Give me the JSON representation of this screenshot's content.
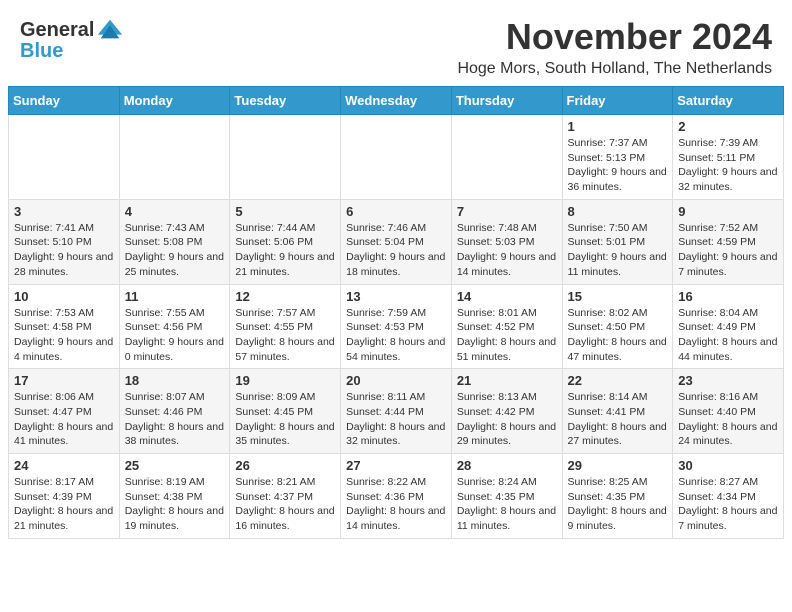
{
  "header": {
    "logo_line1": "General",
    "logo_line2": "Blue",
    "month_title": "November 2024",
    "location": "Hoge Mors, South Holland, The Netherlands"
  },
  "weekdays": [
    "Sunday",
    "Monday",
    "Tuesday",
    "Wednesday",
    "Thursday",
    "Friday",
    "Saturday"
  ],
  "weeks": [
    [
      {
        "day": "",
        "info": ""
      },
      {
        "day": "",
        "info": ""
      },
      {
        "day": "",
        "info": ""
      },
      {
        "day": "",
        "info": ""
      },
      {
        "day": "",
        "info": ""
      },
      {
        "day": "1",
        "info": "Sunrise: 7:37 AM\nSunset: 5:13 PM\nDaylight: 9 hours and 36 minutes."
      },
      {
        "day": "2",
        "info": "Sunrise: 7:39 AM\nSunset: 5:11 PM\nDaylight: 9 hours and 32 minutes."
      }
    ],
    [
      {
        "day": "3",
        "info": "Sunrise: 7:41 AM\nSunset: 5:10 PM\nDaylight: 9 hours and 28 minutes."
      },
      {
        "day": "4",
        "info": "Sunrise: 7:43 AM\nSunset: 5:08 PM\nDaylight: 9 hours and 25 minutes."
      },
      {
        "day": "5",
        "info": "Sunrise: 7:44 AM\nSunset: 5:06 PM\nDaylight: 9 hours and 21 minutes."
      },
      {
        "day": "6",
        "info": "Sunrise: 7:46 AM\nSunset: 5:04 PM\nDaylight: 9 hours and 18 minutes."
      },
      {
        "day": "7",
        "info": "Sunrise: 7:48 AM\nSunset: 5:03 PM\nDaylight: 9 hours and 14 minutes."
      },
      {
        "day": "8",
        "info": "Sunrise: 7:50 AM\nSunset: 5:01 PM\nDaylight: 9 hours and 11 minutes."
      },
      {
        "day": "9",
        "info": "Sunrise: 7:52 AM\nSunset: 4:59 PM\nDaylight: 9 hours and 7 minutes."
      }
    ],
    [
      {
        "day": "10",
        "info": "Sunrise: 7:53 AM\nSunset: 4:58 PM\nDaylight: 9 hours and 4 minutes."
      },
      {
        "day": "11",
        "info": "Sunrise: 7:55 AM\nSunset: 4:56 PM\nDaylight: 9 hours and 0 minutes."
      },
      {
        "day": "12",
        "info": "Sunrise: 7:57 AM\nSunset: 4:55 PM\nDaylight: 8 hours and 57 minutes."
      },
      {
        "day": "13",
        "info": "Sunrise: 7:59 AM\nSunset: 4:53 PM\nDaylight: 8 hours and 54 minutes."
      },
      {
        "day": "14",
        "info": "Sunrise: 8:01 AM\nSunset: 4:52 PM\nDaylight: 8 hours and 51 minutes."
      },
      {
        "day": "15",
        "info": "Sunrise: 8:02 AM\nSunset: 4:50 PM\nDaylight: 8 hours and 47 minutes."
      },
      {
        "day": "16",
        "info": "Sunrise: 8:04 AM\nSunset: 4:49 PM\nDaylight: 8 hours and 44 minutes."
      }
    ],
    [
      {
        "day": "17",
        "info": "Sunrise: 8:06 AM\nSunset: 4:47 PM\nDaylight: 8 hours and 41 minutes."
      },
      {
        "day": "18",
        "info": "Sunrise: 8:07 AM\nSunset: 4:46 PM\nDaylight: 8 hours and 38 minutes."
      },
      {
        "day": "19",
        "info": "Sunrise: 8:09 AM\nSunset: 4:45 PM\nDaylight: 8 hours and 35 minutes."
      },
      {
        "day": "20",
        "info": "Sunrise: 8:11 AM\nSunset: 4:44 PM\nDaylight: 8 hours and 32 minutes."
      },
      {
        "day": "21",
        "info": "Sunrise: 8:13 AM\nSunset: 4:42 PM\nDaylight: 8 hours and 29 minutes."
      },
      {
        "day": "22",
        "info": "Sunrise: 8:14 AM\nSunset: 4:41 PM\nDaylight: 8 hours and 27 minutes."
      },
      {
        "day": "23",
        "info": "Sunrise: 8:16 AM\nSunset: 4:40 PM\nDaylight: 8 hours and 24 minutes."
      }
    ],
    [
      {
        "day": "24",
        "info": "Sunrise: 8:17 AM\nSunset: 4:39 PM\nDaylight: 8 hours and 21 minutes."
      },
      {
        "day": "25",
        "info": "Sunrise: 8:19 AM\nSunset: 4:38 PM\nDaylight: 8 hours and 19 minutes."
      },
      {
        "day": "26",
        "info": "Sunrise: 8:21 AM\nSunset: 4:37 PM\nDaylight: 8 hours and 16 minutes."
      },
      {
        "day": "27",
        "info": "Sunrise: 8:22 AM\nSunset: 4:36 PM\nDaylight: 8 hours and 14 minutes."
      },
      {
        "day": "28",
        "info": "Sunrise: 8:24 AM\nSunset: 4:35 PM\nDaylight: 8 hours and 11 minutes."
      },
      {
        "day": "29",
        "info": "Sunrise: 8:25 AM\nSunset: 4:35 PM\nDaylight: 8 hours and 9 minutes."
      },
      {
        "day": "30",
        "info": "Sunrise: 8:27 AM\nSunset: 4:34 PM\nDaylight: 8 hours and 7 minutes."
      }
    ]
  ]
}
